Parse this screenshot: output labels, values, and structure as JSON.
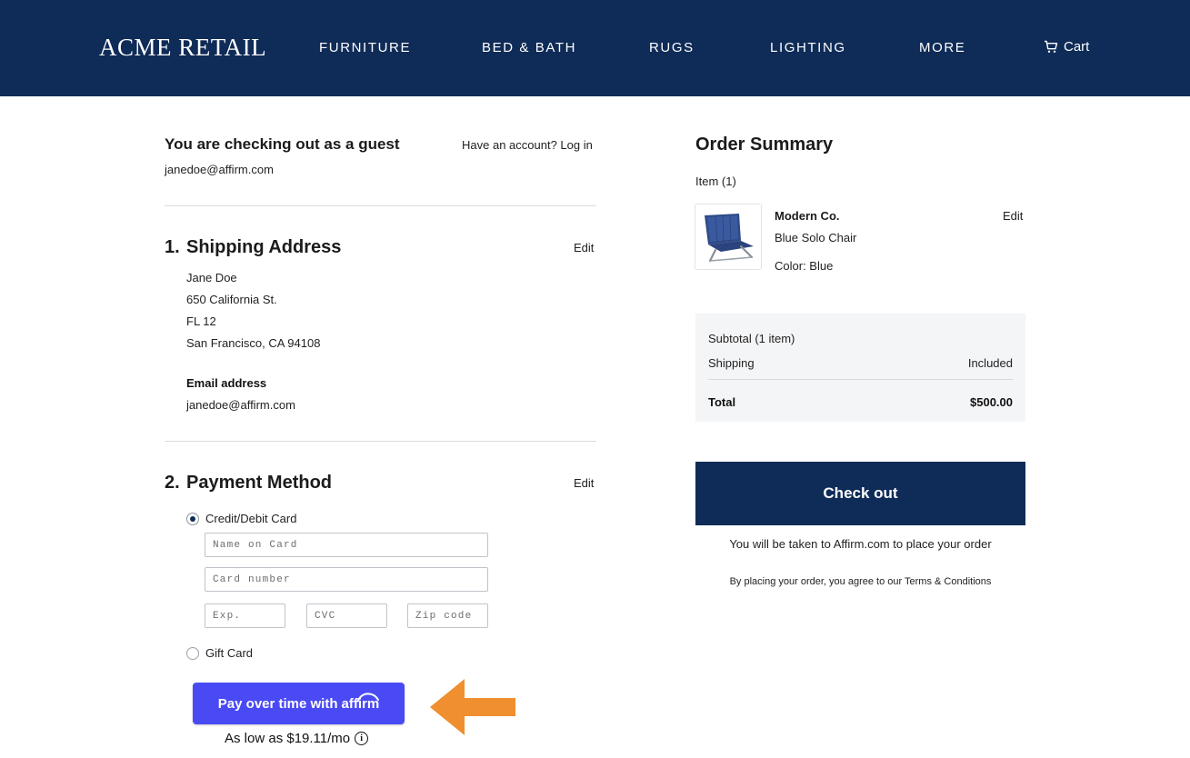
{
  "header": {
    "brand": "ACME RETAIL",
    "nav": [
      "FURNITURE",
      "BED & BATH",
      "RUGS",
      "LIGHTING",
      "MORE"
    ],
    "cart_label": "Cart",
    "cart_icon": "cart-icon"
  },
  "guest": {
    "title": "You are checking out as a guest",
    "login_prompt": "Have an account? Log in",
    "email": "janedoe@affirm.com"
  },
  "shipping": {
    "number": "1.",
    "title": "Shipping Address",
    "edit": "Edit",
    "lines": [
      "Jane Doe",
      "650 California St.",
      "FL 12",
      "San Francisco, CA 94108"
    ],
    "email_label": "Email address",
    "email": "janedoe@affirm.com"
  },
  "payment": {
    "number": "2.",
    "title": "Payment Method",
    "edit": "Edit",
    "credit_label": "Credit/Debit Card",
    "credit_selected": true,
    "name_placeholder": "Name on Card",
    "card_placeholder": "Card number",
    "exp_placeholder": "Exp.",
    "cvc_placeholder": "CVC",
    "zip_placeholder": "Zip code",
    "gift_label": "Gift Card",
    "affirm_prefix": "Pay over time with",
    "affirm_brand": "affirm",
    "as_low": "As low as $19.11/mo",
    "button_color": "#4a4af4",
    "arrow_color": "#ef8f2f"
  },
  "summary": {
    "title": "Order Summary",
    "item_count": "Item (1)",
    "item": {
      "brand": "Modern Co.",
      "name": "Blue Solo Chair",
      "color": "Color: Blue",
      "edit": "Edit"
    },
    "subtotal_label": "Subtotal (1 item)",
    "shipping_label": "Shipping",
    "shipping_value": "Included",
    "total_label": "Total",
    "total_value": "$500.00",
    "checkout": "Check out",
    "redirect_note": "You will be taken to Affirm.com to place your order",
    "terms_note": "By placing your order, you agree to our Terms & Conditions"
  },
  "colors": {
    "navy": "#0f2b57",
    "summary_bg": "#f4f5f7"
  }
}
